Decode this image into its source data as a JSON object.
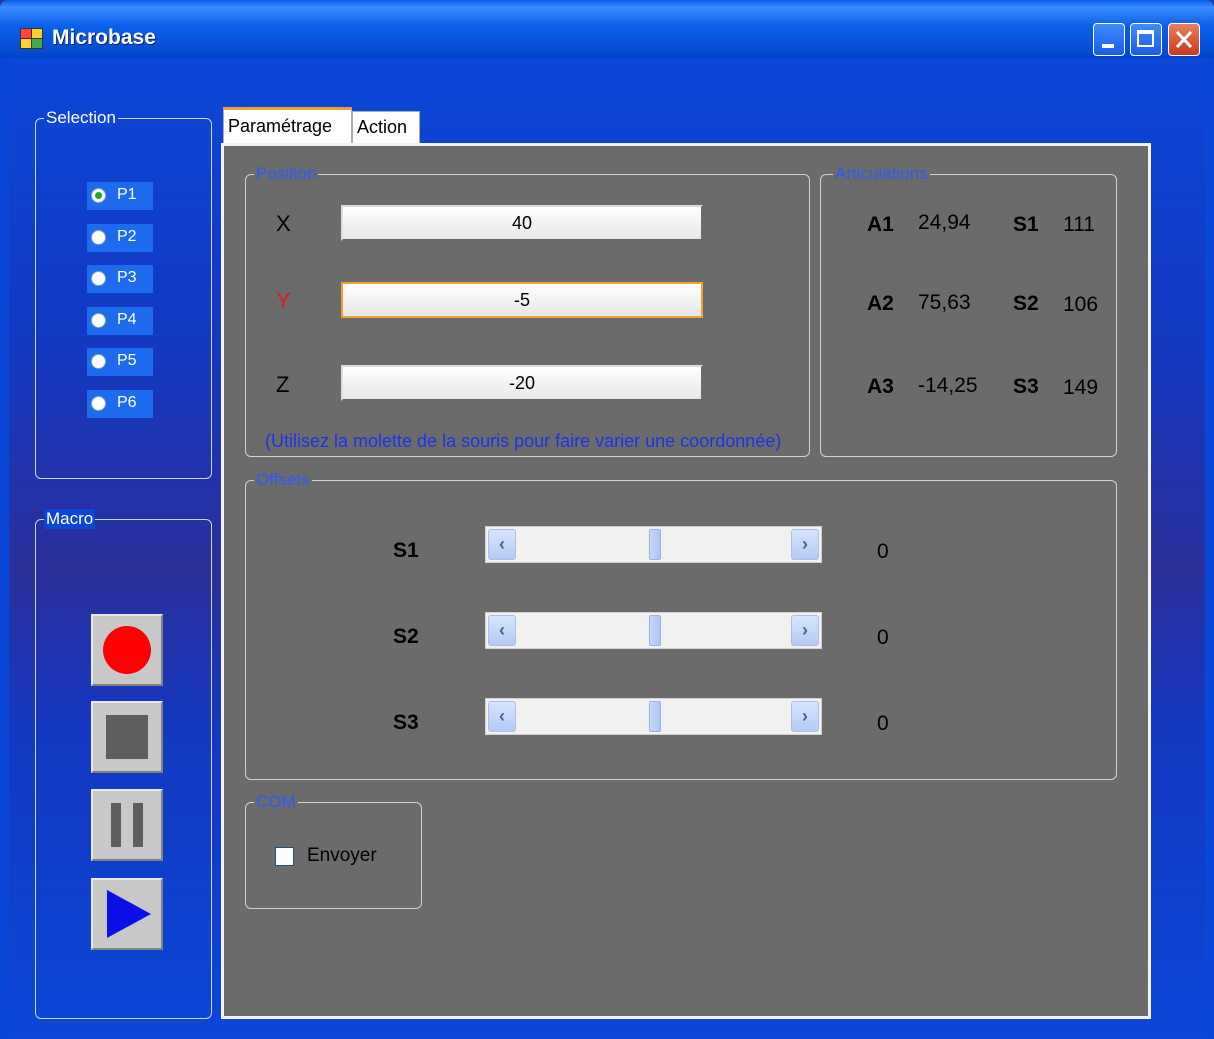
{
  "window": {
    "title": "Microbase"
  },
  "selection": {
    "title": "Selection",
    "items": [
      {
        "label": "P1",
        "checked": true
      },
      {
        "label": "P2",
        "checked": false
      },
      {
        "label": "P3",
        "checked": false
      },
      {
        "label": "P4",
        "checked": false
      },
      {
        "label": "P5",
        "checked": false
      },
      {
        "label": "P6",
        "checked": false
      }
    ]
  },
  "macro": {
    "title": "Macro",
    "buttons": [
      "record-icon",
      "stop-icon",
      "pause-icon",
      "play-icon"
    ]
  },
  "tabs": [
    {
      "label": "Paramétrage",
      "active": true
    },
    {
      "label": "Action",
      "active": false
    }
  ],
  "position": {
    "title": "Position",
    "fields": [
      {
        "axis": "X",
        "value": "40"
      },
      {
        "axis": "Y",
        "value": "-5"
      },
      {
        "axis": "Z",
        "value": "-20"
      }
    ],
    "hint": "(Utilisez la molette de la souris pour faire varier une coordonnée)"
  },
  "articulations": {
    "title": "Articulations",
    "rows": [
      {
        "a_label": "A1",
        "a_value": "24,94",
        "s_label": "S1",
        "s_value": "111"
      },
      {
        "a_label": "A2",
        "a_value": "75,63",
        "s_label": "S2",
        "s_value": "106"
      },
      {
        "a_label": "A3",
        "a_value": "-14,25",
        "s_label": "S3",
        "s_value": "149"
      }
    ]
  },
  "offsets": {
    "title": "Offsets",
    "rows": [
      {
        "label": "S1",
        "value": "0",
        "position": 0.5
      },
      {
        "label": "S2",
        "value": "0",
        "position": 0.5
      },
      {
        "label": "S3",
        "value": "0",
        "position": 0.5
      }
    ]
  },
  "com": {
    "title": "COM",
    "checkbox_label": "Envoyer",
    "checked": false
  },
  "colors": {
    "y_axis": "#e11b1b",
    "groupbox_title": "#2a5cff",
    "hint": "#1b35e6"
  }
}
